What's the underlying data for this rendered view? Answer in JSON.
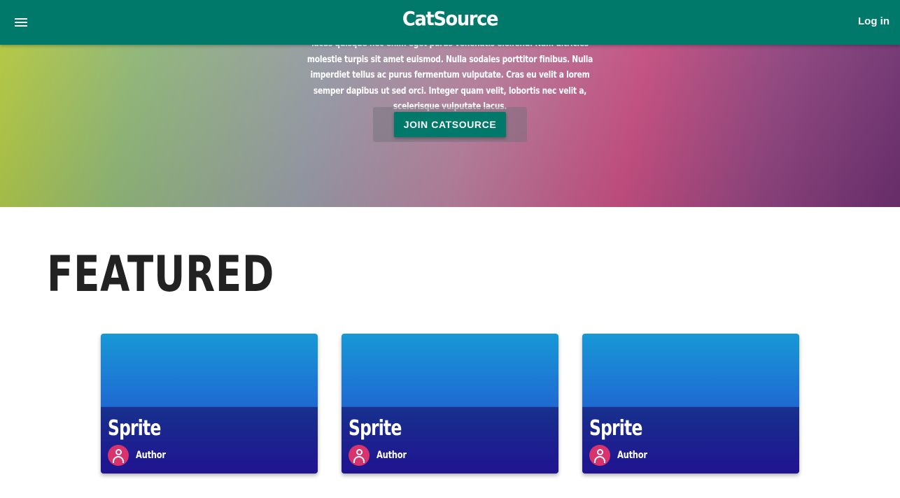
{
  "header": {
    "brand": "CatSource",
    "login_label": "Log in",
    "menu_icon": "hamburger-menu-icon"
  },
  "hero": {
    "text": "lacus quisque nec enim eget purus venenatis eleifend. Nam ultricies molestie turpis sit amet euismod. Nulla sodales porttitor finibus. Nulla imperdiet tellus ac purus fermentum vulputate. Cras eu velit a lorem semper dapibus ut sed orci. Integer quam velit, lobortis nec velit a, scelerisque vulputate lacus.",
    "cta_label": "JOIN CATSOURCE"
  },
  "featured": {
    "title": "FEATURED",
    "cards": [
      {
        "title": "Sprite",
        "author": "Author",
        "avatar_icon": "user-icon"
      },
      {
        "title": "Sprite",
        "author": "Author",
        "avatar_icon": "user-icon"
      },
      {
        "title": "Sprite",
        "author": "Author",
        "avatar_icon": "user-icon"
      }
    ]
  },
  "colors": {
    "primary": "#00796b",
    "avatar": "#d8336d",
    "card_top": "#1898d6",
    "card_bottom": "#22128c"
  }
}
